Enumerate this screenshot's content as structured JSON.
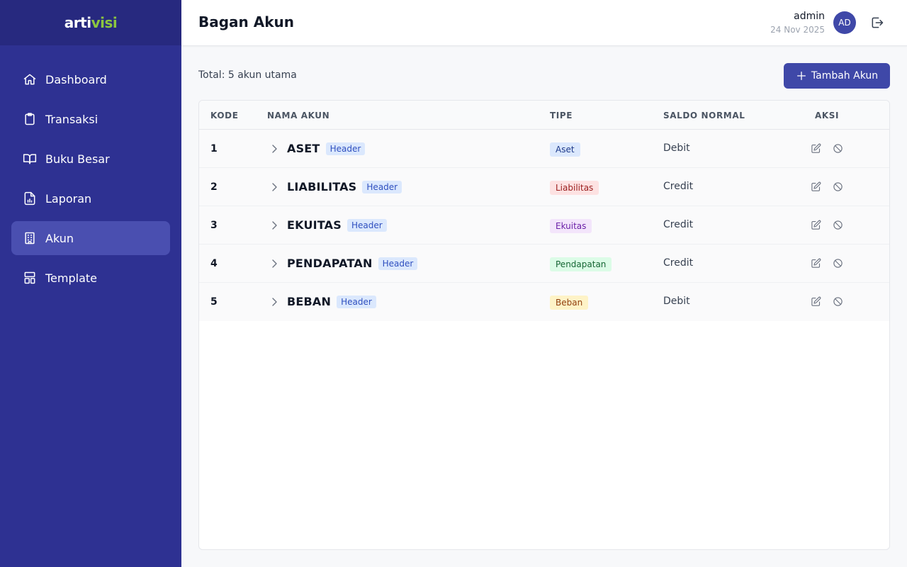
{
  "app": {
    "logo_text_a": "arti",
    "logo_text_b": "visi"
  },
  "sidebar": {
    "items": [
      {
        "label": "Dashboard",
        "icon": "home-icon",
        "active": false
      },
      {
        "label": "Transaksi",
        "icon": "clipboard-icon",
        "active": false
      },
      {
        "label": "Buku Besar",
        "icon": "book-icon",
        "active": false
      },
      {
        "label": "Laporan",
        "icon": "report-icon",
        "active": false
      },
      {
        "label": "Akun",
        "icon": "building-icon",
        "active": true
      },
      {
        "label": "Template",
        "icon": "template-icon",
        "active": false
      }
    ]
  },
  "header": {
    "title": "Bagan Akun",
    "user": "admin",
    "date": "24 Nov 2025",
    "avatar": "AD"
  },
  "toolbar": {
    "total": "Total: 5 akun utama",
    "add_label": "Tambah Akun"
  },
  "table": {
    "headers": {
      "kode": "KODE",
      "nama": "NAMA AKUN",
      "tipe": "TIPE",
      "saldo": "SALDO NORMAL",
      "aksi": "AKSI"
    },
    "rows": [
      {
        "kode": "1",
        "nama": "ASET",
        "badge": "Header",
        "tipe": "Aset",
        "saldo": "Debit"
      },
      {
        "kode": "2",
        "nama": "LIABILITAS",
        "badge": "Header",
        "tipe": "Liabilitas",
        "saldo": "Credit"
      },
      {
        "kode": "3",
        "nama": "EKUITAS",
        "badge": "Header",
        "tipe": "Ekuitas",
        "saldo": "Credit"
      },
      {
        "kode": "4",
        "nama": "PENDAPATAN",
        "badge": "Header",
        "tipe": "Pendapatan",
        "saldo": "Credit"
      },
      {
        "kode": "5",
        "nama": "BEBAN",
        "badge": "Header",
        "tipe": "Beban",
        "saldo": "Debit"
      }
    ]
  },
  "colors": {
    "sidebar_bg": "#2e3192",
    "accent": "#3f48a8",
    "tipe": {
      "Aset": {
        "bg": "#dbe8fd",
        "fg": "#1e3a8a"
      },
      "Liabilitas": {
        "bg": "#fde2e2",
        "fg": "#991b1b"
      },
      "Ekuitas": {
        "bg": "#f3e5fb",
        "fg": "#6b21a8"
      },
      "Pendapatan": {
        "bg": "#dcfce7",
        "fg": "#166534"
      },
      "Beban": {
        "bg": "#fef3c7",
        "fg": "#92400e"
      }
    }
  }
}
